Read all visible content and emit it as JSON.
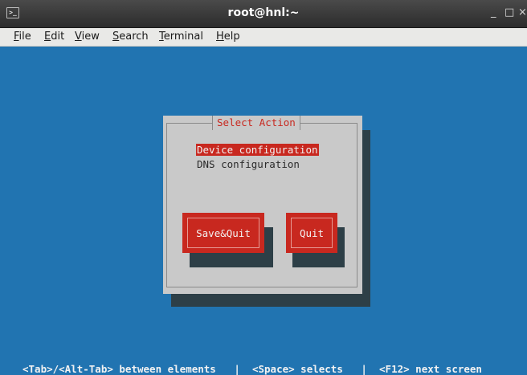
{
  "window": {
    "title": "root@hnl:~",
    "icon": "terminal-icon",
    "minimize_glyph": "_",
    "maximize_glyph": "□",
    "close_glyph": "×"
  },
  "menubar": {
    "items": [
      "File",
      "Edit",
      "View",
      "Search",
      "Terminal",
      "Help"
    ]
  },
  "dialog": {
    "title": "Select Action",
    "options": [
      {
        "label": "Device configuration",
        "selected": true
      },
      {
        "label": "DNS configuration",
        "selected": false
      }
    ],
    "buttons": {
      "save_quit": "Save&Quit",
      "quit": "Quit"
    }
  },
  "statusbar": {
    "text": "<Tab>/<Alt-Tab> between elements   |  <Space> selects   |  <F12> next screen"
  },
  "colors": {
    "terminal_bg": "#2174b1",
    "dialog_bg": "#c9c9c9",
    "accent_red": "#c8281f",
    "shadow": "#2d3f47"
  }
}
